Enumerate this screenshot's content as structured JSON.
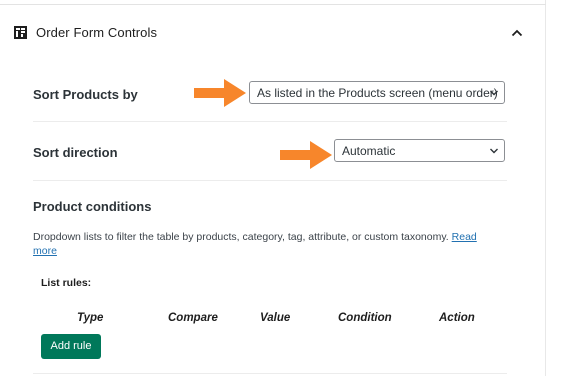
{
  "panel": {
    "title": "Order Form Controls",
    "block_icon": "block-table-icon",
    "collapse_icon": "chevron-up-icon"
  },
  "sort_products": {
    "label": "Sort Products by",
    "selected": "As listed in the Products screen (menu order)",
    "chevron_icon": "chevron-down-icon"
  },
  "sort_direction": {
    "label": "Sort direction",
    "selected": "Automatic",
    "chevron_icon": "chevron-down-icon"
  },
  "product_conditions": {
    "heading": "Product conditions",
    "description": "Dropdown lists to filter the table by products, category, tag, attribute, or custom taxonomy.",
    "read_more_part1": "Read",
    "read_more_part2": "more",
    "list_rules_label": "List rules:",
    "columns": [
      "Type",
      "Compare",
      "Value",
      "Condition",
      "Action"
    ],
    "add_rule_label": "Add rule"
  },
  "annotations": {
    "arrow_color": "#f7862b",
    "arrow_icon": "arrow-right-icon"
  },
  "colors": {
    "accent_button": "#00785a",
    "link": "#2271b1"
  }
}
